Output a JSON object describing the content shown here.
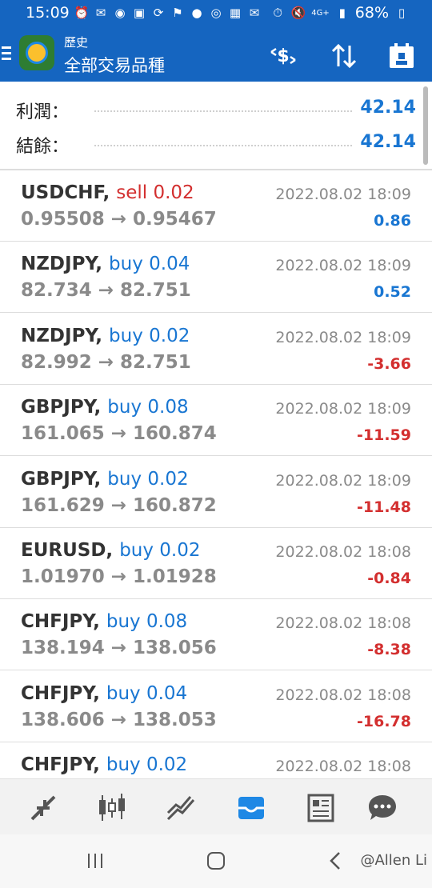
{
  "status_bar": {
    "time": "15:09",
    "network": "4G+",
    "battery": "68%"
  },
  "toolbar": {
    "subtitle": "歷史",
    "title": "全部交易品種"
  },
  "summary": {
    "profit_label": "利潤：",
    "profit_value": "42.14",
    "balance_label": "結餘：",
    "balance_value": "42.14"
  },
  "trades": [
    {
      "symbol": "USDCHF,",
      "side": "sell 0.02",
      "type": "sell",
      "prices": "0.95508 → 0.95467",
      "date": "2022.08.02 18:09",
      "profit": "0.86",
      "profit_sign": "pos"
    },
    {
      "symbol": "NZDJPY,",
      "side": "buy 0.04",
      "type": "buy",
      "prices": "82.734 → 82.751",
      "date": "2022.08.02 18:09",
      "profit": "0.52",
      "profit_sign": "pos"
    },
    {
      "symbol": "NZDJPY,",
      "side": "buy 0.02",
      "type": "buy",
      "prices": "82.992 → 82.751",
      "date": "2022.08.02 18:09",
      "profit": "-3.66",
      "profit_sign": "neg"
    },
    {
      "symbol": "GBPJPY,",
      "side": "buy 0.08",
      "type": "buy",
      "prices": "161.065 → 160.874",
      "date": "2022.08.02 18:09",
      "profit": "-11.59",
      "profit_sign": "neg"
    },
    {
      "symbol": "GBPJPY,",
      "side": "buy 0.02",
      "type": "buy",
      "prices": "161.629 → 160.872",
      "date": "2022.08.02 18:09",
      "profit": "-11.48",
      "profit_sign": "neg"
    },
    {
      "symbol": "EURUSD,",
      "side": "buy 0.02",
      "type": "buy",
      "prices": "1.01970 → 1.01928",
      "date": "2022.08.02 18:08",
      "profit": "-0.84",
      "profit_sign": "neg"
    },
    {
      "symbol": "CHFJPY,",
      "side": "buy 0.08",
      "type": "buy",
      "prices": "138.194 → 138.056",
      "date": "2022.08.02 18:08",
      "profit": "-8.38",
      "profit_sign": "neg"
    },
    {
      "symbol": "CHFJPY,",
      "side": "buy 0.04",
      "type": "buy",
      "prices": "138.606 → 138.053",
      "date": "2022.08.02 18:08",
      "profit": "-16.78",
      "profit_sign": "neg"
    },
    {
      "symbol": "CHFJPY,",
      "side": "buy 0.02",
      "type": "buy",
      "prices": "",
      "date": "2022.08.02 18:08",
      "profit": "",
      "profit_sign": "neg"
    }
  ],
  "bottom_nav": [
    "quotes-icon",
    "chart-icon",
    "trade-icon",
    "history-icon",
    "news-icon",
    "chat-icon"
  ],
  "watermark": "@Allen Li",
  "colors": {
    "header": "#1565c0",
    "positive": "#1976d2",
    "negative": "#d32f2f",
    "muted": "#8a8a8a"
  }
}
